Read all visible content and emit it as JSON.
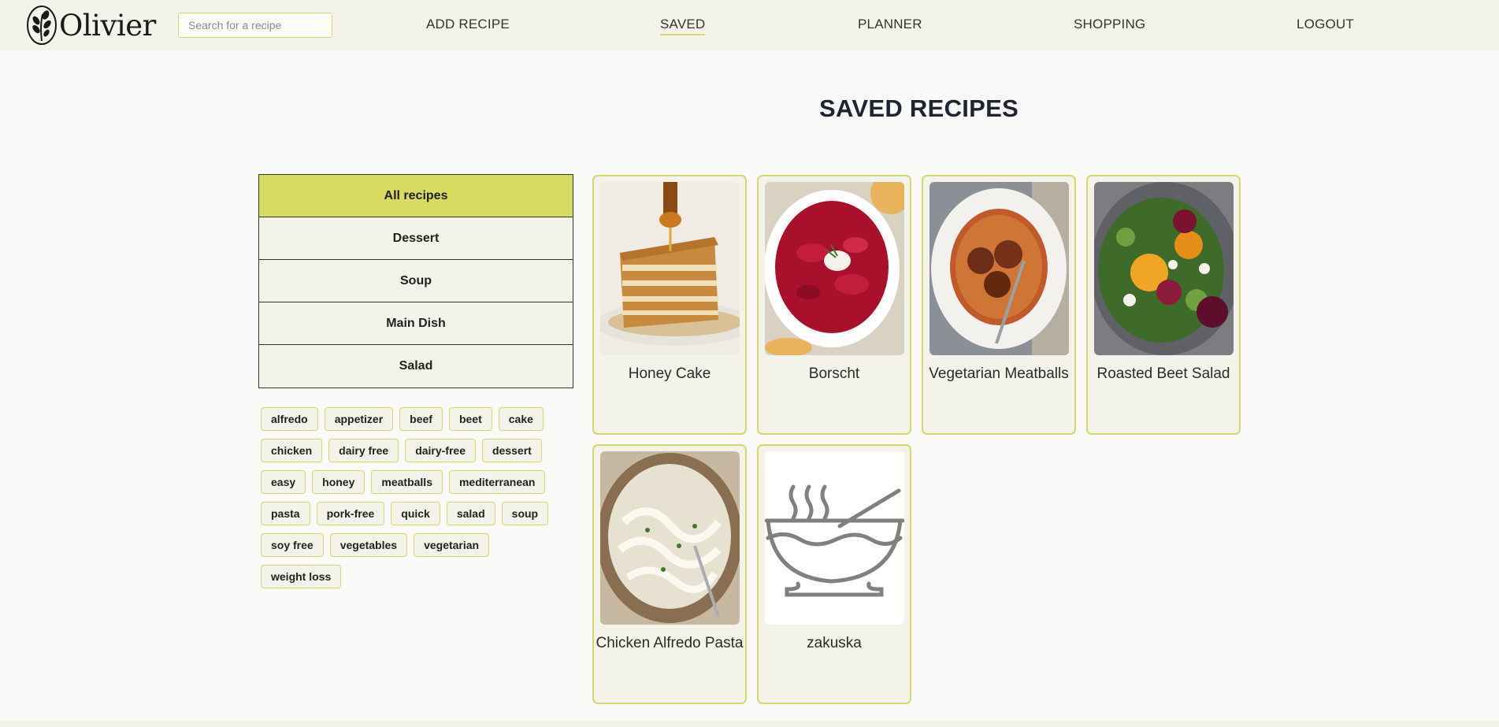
{
  "brand": {
    "name": "Olivier",
    "icon": "olive-branch-icon"
  },
  "search": {
    "placeholder": "Search for a recipe",
    "value": ""
  },
  "nav": {
    "add_recipe": "ADD RECIPE",
    "saved": "SAVED",
    "planner": "PLANNER",
    "shopping": "SHOPPING",
    "logout": "LOGOUT",
    "active": "SAVED"
  },
  "page": {
    "title": "SAVED RECIPES"
  },
  "categories": [
    {
      "label": "All recipes",
      "active": true
    },
    {
      "label": "Dessert",
      "active": false
    },
    {
      "label": "Soup",
      "active": false
    },
    {
      "label": "Main Dish",
      "active": false
    },
    {
      "label": "Salad",
      "active": false
    }
  ],
  "tags": [
    "alfredo",
    "appetizer",
    "beef",
    "beet",
    "cake",
    "chicken",
    "dairy free",
    "dairy-free",
    "dessert",
    "easy",
    "honey",
    "meatballs",
    "mediterranean",
    "pasta",
    "pork-free",
    "quick",
    "salad",
    "soup",
    "soy free",
    "vegetables",
    "vegetarian",
    "weight loss"
  ],
  "recipes": [
    {
      "title": "Honey Cake",
      "image": "honey-cake-photo"
    },
    {
      "title": "Borscht",
      "image": "borscht-photo"
    },
    {
      "title": "Vegetarian Meatballs",
      "image": "spaghetti-meatballs-photo"
    },
    {
      "title": "Roasted Beet Salad",
      "image": "beet-salad-photo"
    },
    {
      "title": "Chicken Alfredo Pasta",
      "image": "alfredo-pasta-photo"
    },
    {
      "title": "zakuska",
      "image": "soup-bowl-placeholder-icon"
    }
  ],
  "colors": {
    "accent": "#d8db5f",
    "header_bg": "#f4f3ea",
    "page_bg": "#f9f9f7",
    "title": "#1e2430"
  }
}
